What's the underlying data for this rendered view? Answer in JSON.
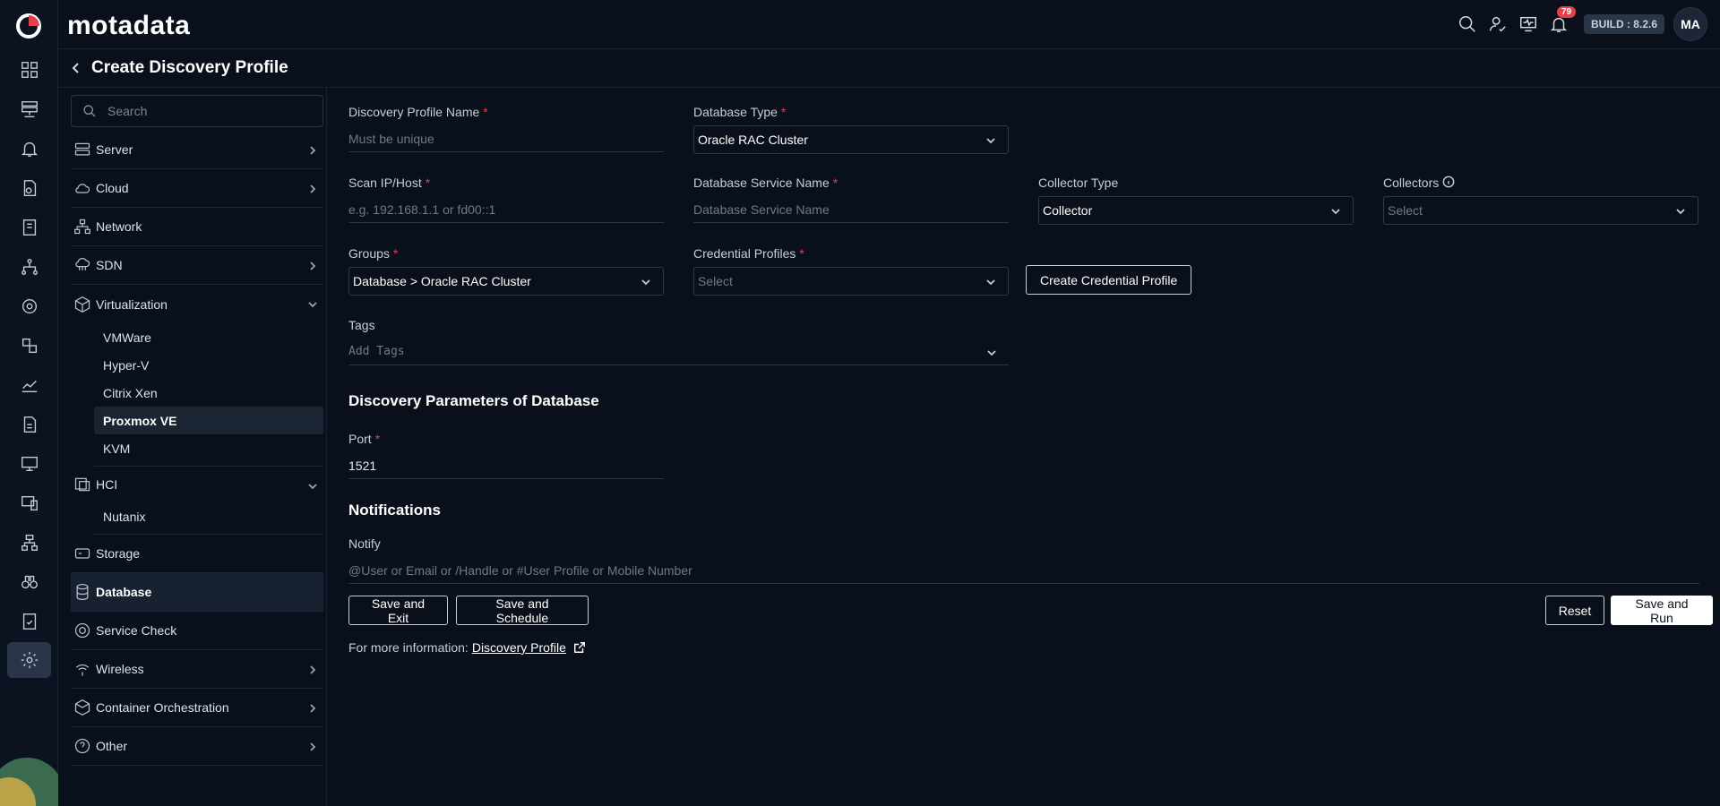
{
  "brand": {
    "name": "motadata"
  },
  "topbar": {
    "notification_count": "79",
    "build_label": "BUILD : 8.2.6",
    "avatar_initials": "MA"
  },
  "page": {
    "title": "Create Discovery Profile"
  },
  "category_sidebar": {
    "search_placeholder": "Search",
    "items": [
      {
        "label": "Server",
        "icon": "server-icon",
        "expandable": true
      },
      {
        "label": "Cloud",
        "icon": "cloud-icon",
        "expandable": true
      },
      {
        "label": "Network",
        "icon": "network-icon",
        "expandable": false
      },
      {
        "label": "SDN",
        "icon": "sdn-icon",
        "expandable": true
      },
      {
        "label": "Virtualization",
        "icon": "cube-icon",
        "expanded": true,
        "children": [
          "VMWare",
          "Hyper-V",
          "Citrix Xen",
          "Proxmox VE",
          "KVM"
        ],
        "selected_child": "Proxmox VE"
      },
      {
        "label": "HCI",
        "icon": "hci-icon",
        "expanded": true,
        "children": [
          "Nutanix"
        ]
      },
      {
        "label": "Storage",
        "icon": "storage-icon",
        "expandable": false
      },
      {
        "label": "Database",
        "icon": "database-icon",
        "selected": true
      },
      {
        "label": "Service Check",
        "icon": "service-check-icon",
        "expandable": false
      },
      {
        "label": "Wireless",
        "icon": "wireless-icon",
        "expandable": true
      },
      {
        "label": "Container Orchestration",
        "icon": "container-icon",
        "expandable": true
      },
      {
        "label": "Other",
        "icon": "question-icon",
        "expandable": true
      }
    ]
  },
  "form": {
    "profile_name": {
      "label": "Discovery Profile Name",
      "placeholder": "Must be unique"
    },
    "database_type": {
      "label": "Database Type",
      "value": "Oracle RAC Cluster"
    },
    "scan_ip": {
      "label": "Scan IP/Host",
      "placeholder": "e.g. 192.168.1.1 or fd00::1"
    },
    "db_service_name": {
      "label": "Database Service Name",
      "placeholder": "Database Service Name"
    },
    "collector_type": {
      "label": "Collector Type",
      "value": "Collector"
    },
    "collectors": {
      "label": "Collectors",
      "placeholder": "Select"
    },
    "groups": {
      "label": "Groups",
      "value": "Database > Oracle RAC Cluster"
    },
    "credential_profiles": {
      "label": "Credential Profiles",
      "placeholder": "Select"
    },
    "create_credential_button": "Create Credential Profile",
    "tags": {
      "label": "Tags",
      "placeholder": "Add Tags"
    },
    "discovery_params_title": "Discovery Parameters of Database",
    "port": {
      "label": "Port",
      "value": "1521"
    },
    "notifications_title": "Notifications",
    "notify": {
      "label": "Notify",
      "placeholder": "@User or Email or /Handle or #User Profile or Mobile Number"
    },
    "buttons": {
      "save_exit": "Save and Exit",
      "save_schedule": "Save and Schedule",
      "reset": "Reset",
      "save_run": "Save and Run"
    },
    "more_info": {
      "prefix": "For more information:",
      "link": "Discovery Profile"
    }
  }
}
